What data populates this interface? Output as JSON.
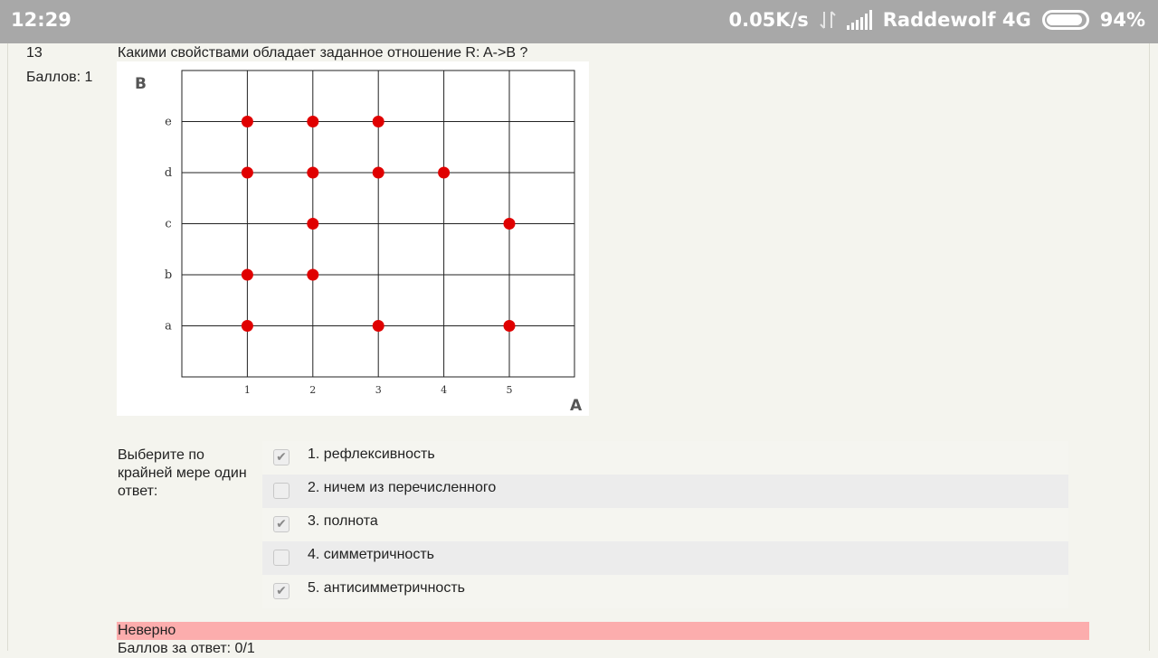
{
  "status_bar": {
    "time": "12:29",
    "speed": "0.05K/s",
    "carrier": "Raddewolf 4G",
    "battery": "94%",
    "battery_level": 0.94
  },
  "question": {
    "number": "13",
    "points": "Баллов: 1",
    "text": "Какими свойствами обладает заданное отношение R: A->B ?"
  },
  "chart_data": {
    "type": "scatter",
    "x_axis_label": "A",
    "y_axis_label": "B",
    "x_ticks": [
      "1",
      "2",
      "3",
      "4",
      "5"
    ],
    "y_ticks": [
      "a",
      "b",
      "c",
      "d",
      "e"
    ],
    "grid": true,
    "point_color": "#e00000",
    "points": [
      {
        "x": "1",
        "y": "e"
      },
      {
        "x": "2",
        "y": "e"
      },
      {
        "x": "3",
        "y": "e"
      },
      {
        "x": "1",
        "y": "d"
      },
      {
        "x": "2",
        "y": "d"
      },
      {
        "x": "3",
        "y": "d"
      },
      {
        "x": "4",
        "y": "d"
      },
      {
        "x": "2",
        "y": "c"
      },
      {
        "x": "5",
        "y": "c"
      },
      {
        "x": "1",
        "y": "b"
      },
      {
        "x": "2",
        "y": "b"
      },
      {
        "x": "1",
        "y": "a"
      },
      {
        "x": "3",
        "y": "a"
      },
      {
        "x": "5",
        "y": "a"
      }
    ]
  },
  "prompt": "Выберите по крайней мере один ответ:",
  "answers": [
    {
      "label": "1. рефлексивность",
      "checked": true
    },
    {
      "label": "2. ничем из перечисленного",
      "checked": false
    },
    {
      "label": "3. полнота",
      "checked": true
    },
    {
      "label": "4. симметричность",
      "checked": false
    },
    {
      "label": "5. антисимметричность",
      "checked": true
    }
  ],
  "feedback": {
    "result": "Неверно",
    "score": "Баллов за ответ: 0/1",
    "color": "#fcadad"
  }
}
